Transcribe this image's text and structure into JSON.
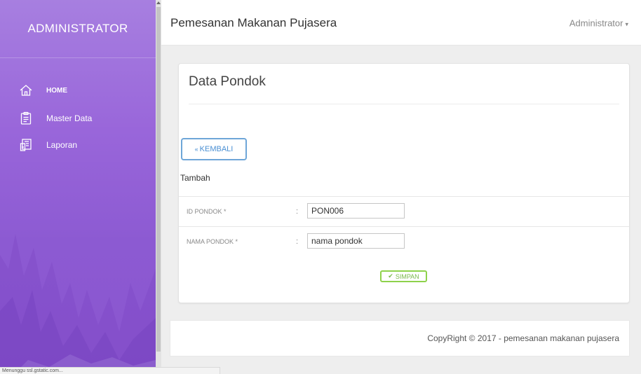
{
  "sidebar": {
    "brand": "ADMINISTRATOR",
    "items": [
      {
        "label": "HOME",
        "icon": "home-icon"
      },
      {
        "label": "Master Data",
        "icon": "clipboard-icon"
      },
      {
        "label": "Laporan",
        "icon": "report-icon"
      }
    ]
  },
  "header": {
    "title": "Pemesanan Makanan Pujasera",
    "user": "Administrator",
    "user_caret": "▾"
  },
  "card": {
    "title": "Data Pondok",
    "back_label": "KEMBALI",
    "back_icon": "«",
    "sub_label": "Tambah",
    "fields": [
      {
        "label": "ID PONDOK *",
        "colon": ":",
        "value": "PON006",
        "placeholder": ""
      },
      {
        "label": "NAMA PONDOK *",
        "colon": ":",
        "value": "",
        "placeholder": "nama pondok"
      }
    ],
    "save_label": "SIMPAN",
    "save_icon": "✔"
  },
  "footer": {
    "text": "CopyRight © 2017 - pemesanan makanan pujasera"
  },
  "statusbar": {
    "text": "Menunggu ssl.gstatic.com..."
  },
  "colors": {
    "sidebar_top": "#a77fe0",
    "sidebar_bottom": "#8a55cf",
    "primary": "#4a8fd3",
    "success": "#8ed24b"
  }
}
